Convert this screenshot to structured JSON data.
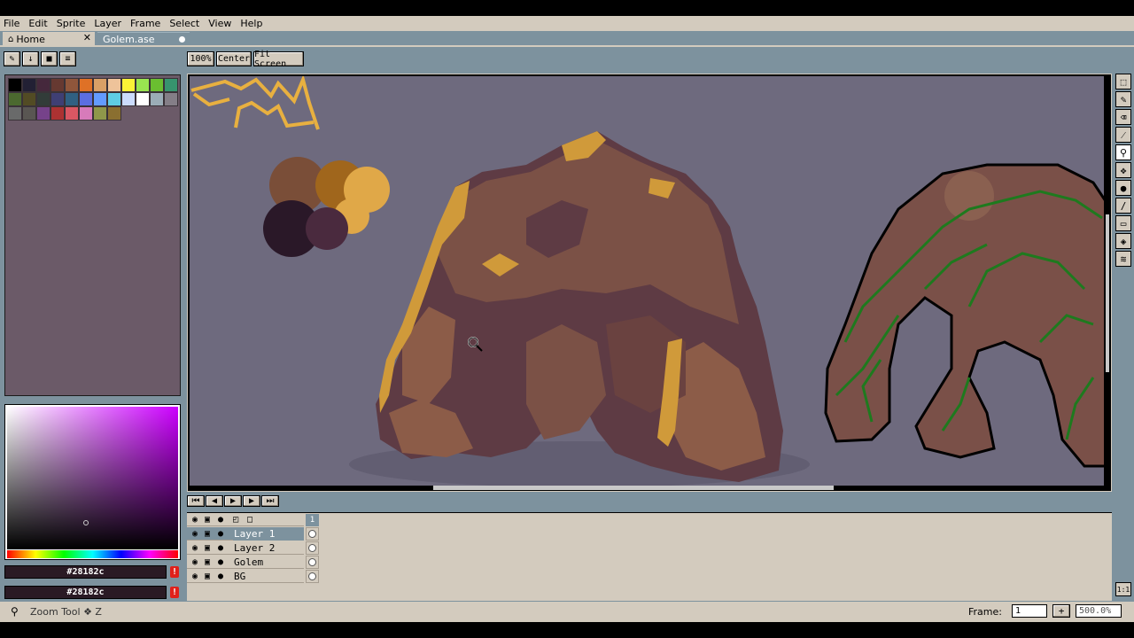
{
  "menubar": {
    "items": [
      "File",
      "Edit",
      "Sprite",
      "Layer",
      "Frame",
      "Select",
      "View",
      "Help"
    ]
  },
  "tabs": [
    {
      "label": "Home",
      "icon": "home-icon"
    },
    {
      "label": "Golem.ase",
      "icon": "modified-dot"
    }
  ],
  "canvas_toolbar": {
    "zoom_label": "100%",
    "center_label": "Center",
    "fit_label": "Fit Screen"
  },
  "palette": {
    "colors": [
      "#000000",
      "#222034",
      "#45283c",
      "#663931",
      "#8f563b",
      "#df7126",
      "#d9a066",
      "#eec39a",
      "#fbf236",
      "#99e550",
      "#6abe30",
      "#37946e",
      "#4b692f",
      "#524b24",
      "#323c39",
      "#3f3f74",
      "#306082",
      "#5b6ee1",
      "#639bff",
      "#5fcde4",
      "#cbdbfc",
      "#ffffff",
      "#9badb7",
      "#847e87",
      "#696a6a",
      "#595652",
      "#76428a",
      "#ac3232",
      "#d95763",
      "#d77bba",
      "#8f974a",
      "#8a6f30"
    ]
  },
  "colors": {
    "foreground_hex": "#28182c",
    "background_hex": "#28182c"
  },
  "timeline": {
    "frame_number": "1",
    "layers": [
      {
        "name": "Layer 1",
        "selected": true
      },
      {
        "name": "Layer 2",
        "selected": false
      },
      {
        "name": "Golem",
        "selected": false
      },
      {
        "name": "BG",
        "selected": false
      }
    ]
  },
  "status": {
    "tool_text": "Zoom Tool ❖ Z",
    "frame_label": "Frame:",
    "frame_value": "1",
    "zoom_value": "500.0%"
  }
}
